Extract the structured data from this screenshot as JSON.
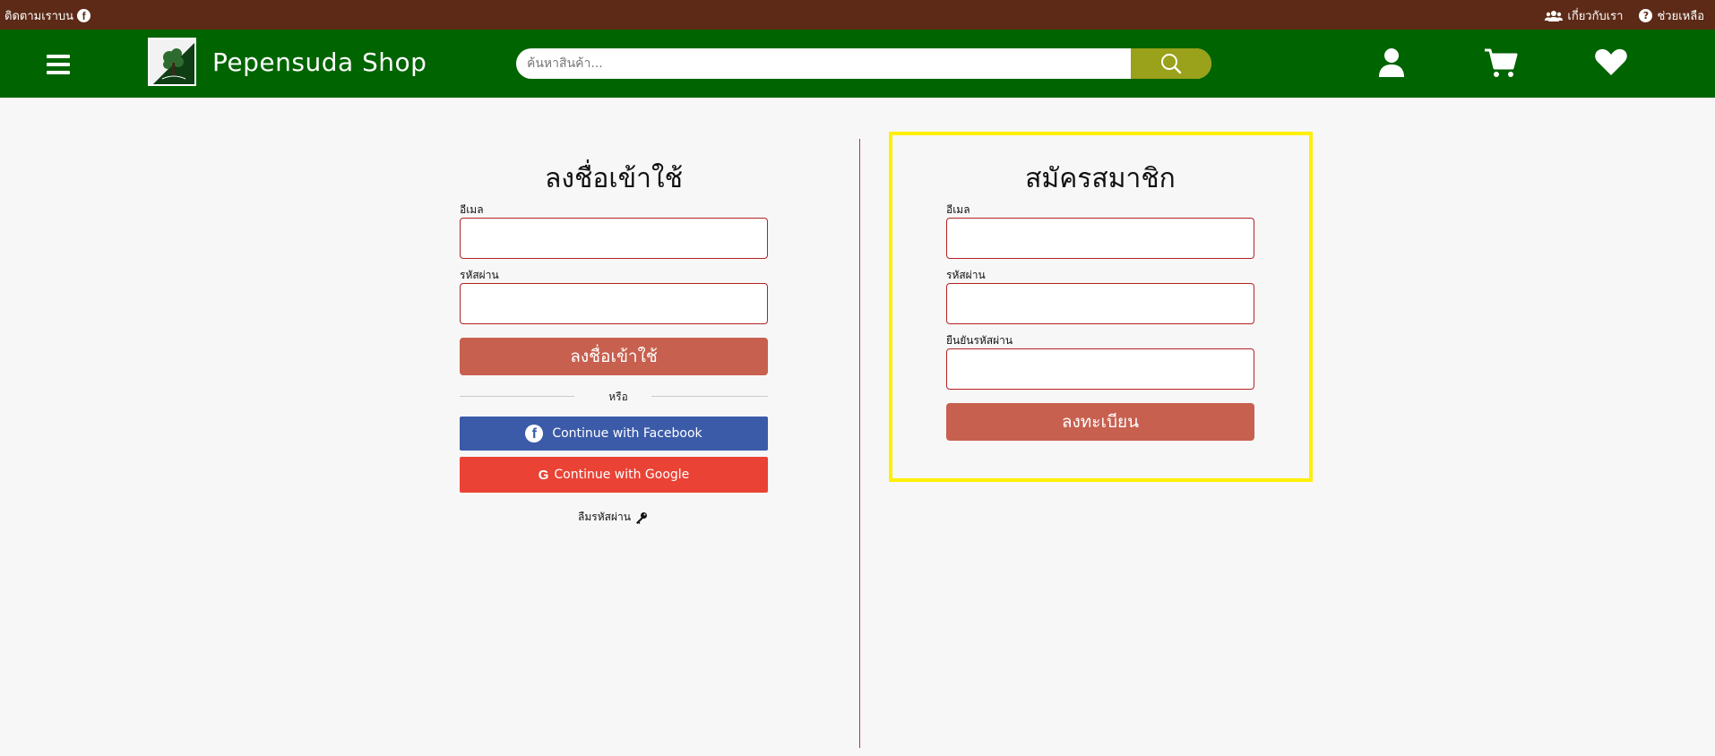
{
  "topbar": {
    "follow_text": "ติดตามเราบน",
    "follow_icon": "facebook-icon",
    "about_label": "เกี่ยวกับเรา",
    "about_icon": "users-icon",
    "help_label": "ช่วยเหลือ",
    "help_icon": "question-circle-icon"
  },
  "navbar": {
    "brand": "Pepensuda Shop",
    "search_placeholder": "ค้นหาสินค้า...",
    "icons": [
      "menu-icon",
      "search-icon",
      "user-icon",
      "cart-icon",
      "heart-icon"
    ]
  },
  "login": {
    "title": "ลงชื่อเข้าใช้",
    "email_label": "อีเมล",
    "password_label": "รหัสผ่าน",
    "submit_label": "ลงชื่อเข้าใช้",
    "or_text": "หรือ",
    "facebook_label": "Continue with Facebook",
    "google_label": "Continue with Google",
    "forgot_label": "ลืมรหัสผ่าน",
    "forgot_icon": "key-icon"
  },
  "register": {
    "title": "สมัครสมาชิก",
    "email_label": "อีเมล",
    "password_label": "รหัสผ่าน",
    "confirm_label": "ยืนยันรหัสผ่าน",
    "submit_label": "ลงทะเบียน"
  },
  "colors": {
    "topbar": "#5c2a17",
    "navbar": "#006400",
    "search_button": "#9aa11a",
    "primary_button": "#c7604f",
    "facebook": "#3b5ba9",
    "google": "#ea4335",
    "highlight_border": "#ffef00",
    "input_border": "#b22222"
  }
}
